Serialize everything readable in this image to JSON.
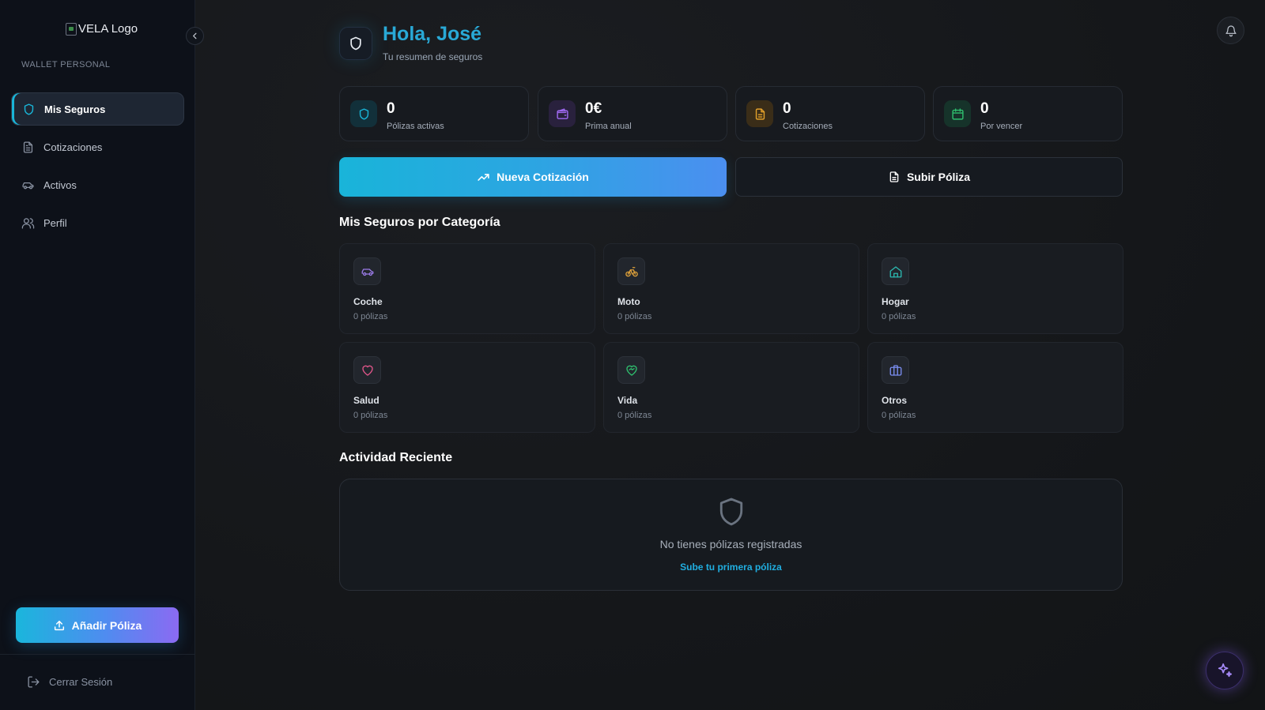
{
  "sidebar": {
    "logo_alt": "VELA Logo",
    "section_label": "WALLET PERSONAL",
    "items": [
      {
        "label": "Mis Seguros",
        "icon": "shield-icon",
        "active": true
      },
      {
        "label": "Cotizaciones",
        "icon": "document-icon",
        "active": false
      },
      {
        "label": "Activos",
        "icon": "car-icon",
        "active": false
      },
      {
        "label": "Perfil",
        "icon": "users-icon",
        "active": false
      }
    ],
    "add_policy_label": "Añadir Póliza",
    "logout_label": "Cerrar Sesión"
  },
  "header": {
    "greeting": "Hola, José",
    "subtitle": "Tu resumen de seguros"
  },
  "stats": [
    {
      "value": "0",
      "label": "Pólizas activas",
      "icon": "shield-icon",
      "color": "#19b5d8"
    },
    {
      "value": "0€",
      "label": "Prima anual",
      "icon": "wallet-icon",
      "color": "#a06af2"
    },
    {
      "value": "0",
      "label": "Cotizaciones",
      "icon": "document-icon",
      "color": "#e3a12a"
    },
    {
      "value": "0",
      "label": "Por vencer",
      "icon": "calendar-icon",
      "color": "#2fbf6e"
    }
  ],
  "actions": {
    "new_quote": "Nueva Cotización",
    "upload_policy": "Subir Póliza"
  },
  "categories_title": "Mis Seguros por Categoría",
  "categories": [
    {
      "name": "Coche",
      "count": "0 pólizas",
      "icon": "car-icon",
      "color": "#9b7be8"
    },
    {
      "name": "Moto",
      "count": "0 pólizas",
      "icon": "bike-icon",
      "color": "#e0a23a"
    },
    {
      "name": "Hogar",
      "count": "0 pólizas",
      "icon": "home-icon",
      "color": "#2bb8b0"
    },
    {
      "name": "Salud",
      "count": "0 pólizas",
      "icon": "heart-icon",
      "color": "#e0568a"
    },
    {
      "name": "Vida",
      "count": "0 pólizas",
      "icon": "heart-handshake-icon",
      "color": "#2fbf6e"
    },
    {
      "name": "Otros",
      "count": "0 pólizas",
      "icon": "briefcase-icon",
      "color": "#7a8df0"
    }
  ],
  "activity": {
    "title": "Actividad Reciente",
    "empty_text": "No tienes pólizas registradas",
    "empty_link": "Sube tu primera póliza"
  },
  "colors": {
    "accent": "#19b5d8",
    "sidebar_bg": "#0d1119",
    "main_bg": "#15171a"
  }
}
